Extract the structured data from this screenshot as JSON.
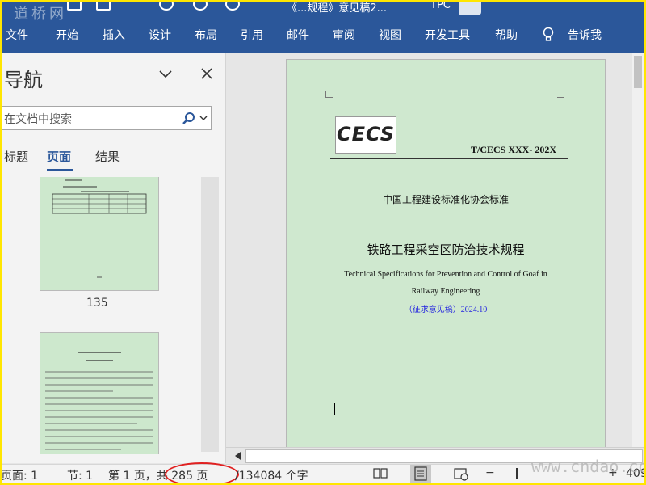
{
  "ribbon": {
    "title": "《...规程》意见稿2...",
    "user_label": "TPC",
    "tabs": [
      "文件",
      "开始",
      "插入",
      "设计",
      "布局",
      "引用",
      "邮件",
      "审阅",
      "视图",
      "开发工具",
      "帮助",
      "告诉我"
    ],
    "color": "#2b579a"
  },
  "watermark": {
    "left": "道桥网",
    "right": "www.cndao.com"
  },
  "nav": {
    "title": "导航",
    "search_placeholder": "在文档中搜索",
    "tabs": [
      "标题",
      "页面",
      "结果"
    ],
    "active_tab": "页面",
    "thumbnail_number": "135"
  },
  "document": {
    "logo_text": "CECS",
    "standard_number": "T/CECS XXX- 202X",
    "association": "中国工程建设标准化协会标准",
    "title_cn": "铁路工程采空区防治技术规程",
    "title_en_line1": "Technical Specifications for Prevention and Control of Goaf in",
    "title_en_line2": "Railway Engineering",
    "draft_note": "（征求意见稿）2024.10",
    "page_color": "#cfe8cf"
  },
  "status": {
    "page": "页面: 1",
    "section": "节: 1",
    "page_of": "第 1 页，共 285 页",
    "word_count": "/134084 个字",
    "zoom": "409"
  }
}
